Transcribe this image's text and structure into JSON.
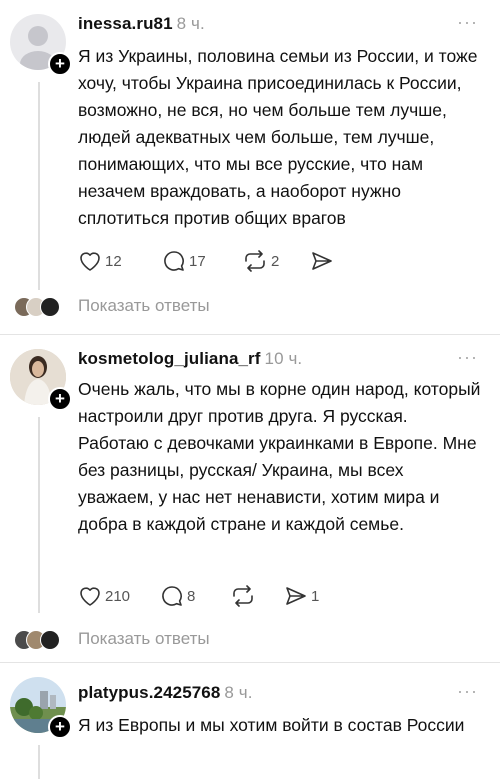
{
  "posts": [
    {
      "username": "inessa.ru81",
      "time": "8 ч.",
      "text": "Я из Украины, половина семьи из России, и тоже хочу, чтобы Украина присоединилась к России, возможно, не вся, но чем больше тем лучше, людей адекватных чем больше, тем лучше, понимающих, что мы все русские, что нам незачем враждовать, а наоборот нужно сплотиться против общих врагов",
      "likes": "12",
      "comments": "17",
      "reposts": "2",
      "shares": ""
    },
    {
      "username": "kosmetolog_juliana_rf",
      "time": "10 ч.",
      "text": "Очень жаль, что мы в корне один народ, который настроили друг против друга. Я русская. Работаю с девочками украинками в Европе. Мне без разницы, русская/ Украина, мы всех уважаем, у нас нет ненависти, хотим мира и добра в каждой стране и каждой семье.",
      "likes": "210",
      "comments": "8",
      "reposts": "",
      "shares": "1"
    },
    {
      "username": "platypus.2425768",
      "time": "8 ч.",
      "text": "Я из Европы и мы хотим войти в состав России"
    }
  ],
  "show_replies_label": "Показать ответы",
  "more_label": "···",
  "plus_label": "+",
  "colors": {
    "text": "#111111",
    "muted": "#999999",
    "divider": "#e4e4e4"
  }
}
